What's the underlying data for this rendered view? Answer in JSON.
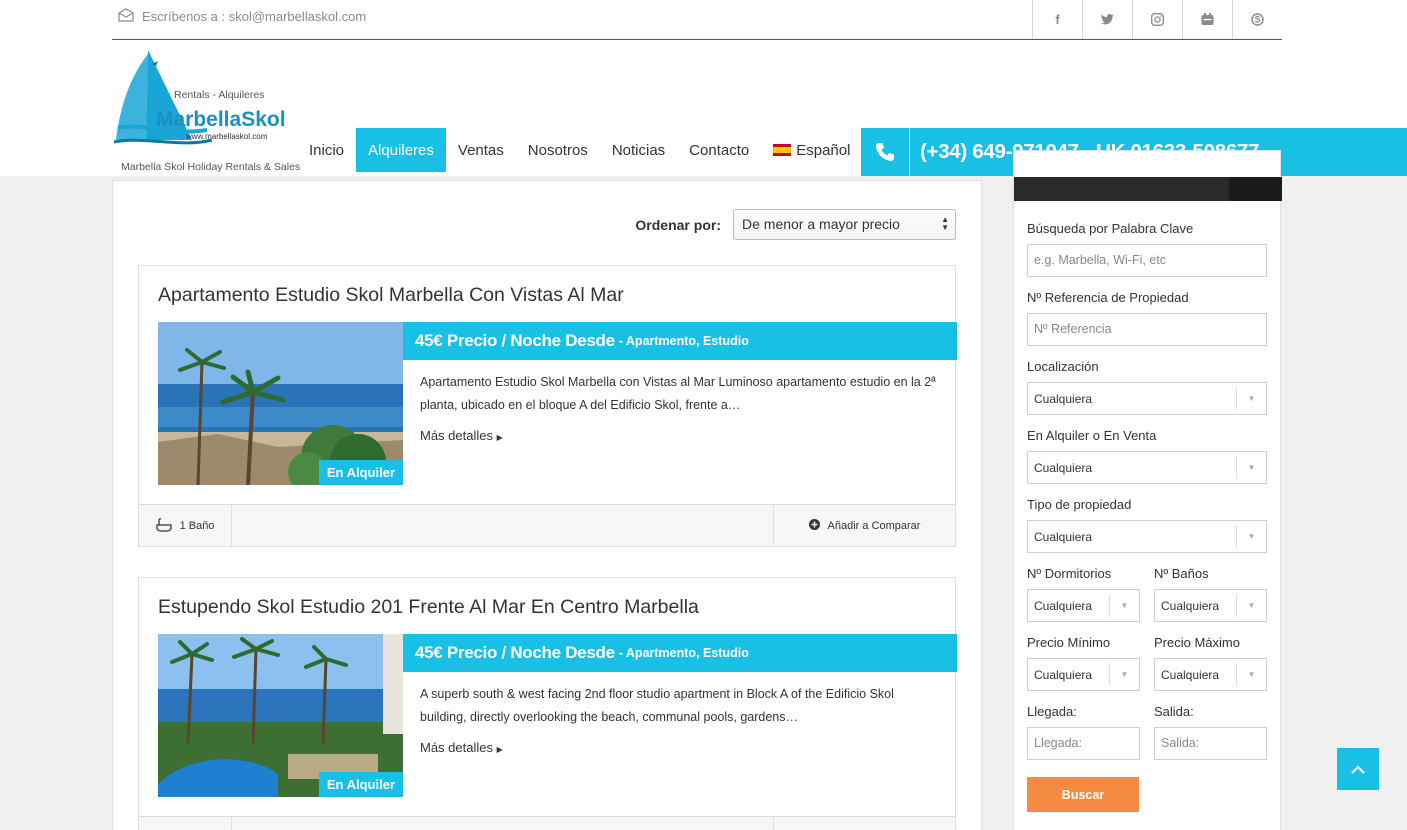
{
  "topbar": {
    "email_text": "Escríbenos a : skol@marbellaskol.com",
    "socials": [
      "facebook-icon",
      "twitter-icon",
      "instagram-icon",
      "youtube-icon",
      "skype-icon"
    ]
  },
  "logo": {
    "rentals": "Rentals - Alquileres",
    "brand": "MarbellaSkol",
    "url": "www.marbellaskol.com",
    "tagline": "Marbella Skol Holiday Rentals & Sales"
  },
  "nav": {
    "items": [
      "Inicio",
      "Alquileres",
      "Ventas",
      "Nosotros",
      "Noticias",
      "Contacto"
    ],
    "active": "Alquileres",
    "language": "Español"
  },
  "phone": "(+34) 649-971047 - UK 01633-508677",
  "sort": {
    "label": "Ordenar por:",
    "value": "De menor a mayor precio"
  },
  "listings": [
    {
      "title": "Apartamento Estudio Skol Marbella Con Vistas Al Mar",
      "price": "45€ Precio / Noche Desde",
      "types": "- Apartmento, Estudio",
      "description": "Apartamento Estudio Skol Marbella con Vistas al Mar Luminoso apartamento estudio en la 2ª planta, ubicado en el bloque A del Edificio Skol, frente a…",
      "more": "Más detalles",
      "badge": "En Alquiler",
      "baths": "1 Baño",
      "compare": "Añadir a Comparar"
    },
    {
      "title": "Estupendo Skol Estudio 201 Frente Al Mar En Centro Marbella",
      "price": "45€ Precio / Noche Desde",
      "types": "- Apartmento, Estudio",
      "description": "A superb south & west facing 2nd floor studio apartment in Block A of the Edificio Skol building, directly overlooking the beach, communal pools, gardens…",
      "more": "Más detalles",
      "badge": "En Alquiler"
    }
  ],
  "search": {
    "keyword_label": "Búsqueda por Palabra Clave",
    "keyword_placeholder": "e.g. Marbella, Wi-Fi, etc",
    "ref_label": "Nº Referencia de Propiedad",
    "ref_placeholder": "Nº Referencia",
    "location_label": "Localización",
    "location_value": "Cualquiera",
    "status_label": "En Alquiler o En Venta",
    "status_value": "Cualquiera",
    "type_label": "Tipo de propiedad",
    "type_value": "Cualquiera",
    "bedrooms_label": "Nº Dormitorios",
    "bedrooms_value": "Cualquiera",
    "baths_label": "Nº Baños",
    "baths_value": "Cualquiera",
    "min_price_label": "Precio Mínimo",
    "min_price_value": "Cualquiera",
    "max_price_label": "Precio Máximo",
    "max_price_value": "Cualquiera",
    "arrival_label": "Llegada:",
    "arrival_placeholder": "Llegada:",
    "departure_label": "Salida:",
    "departure_placeholder": "Salida:",
    "submit": "Buscar"
  },
  "colors": {
    "accent": "#19c0e6",
    "search_button": "#f58a42",
    "dark": "#2a2a2a"
  }
}
